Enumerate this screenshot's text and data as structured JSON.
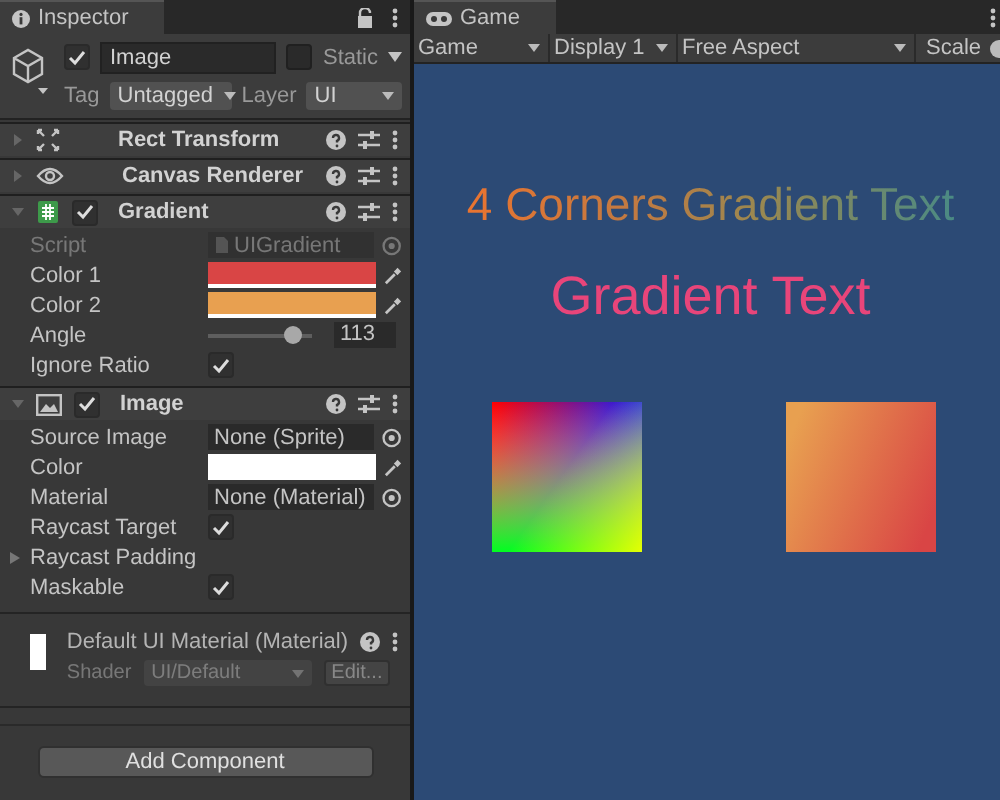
{
  "inspector": {
    "tab_title": "Inspector",
    "object": {
      "active": true,
      "name": "Image",
      "static": false,
      "static_label": "Static",
      "tag_label": "Tag",
      "tag": "Untagged",
      "layer_label": "Layer",
      "layer": "UI"
    },
    "components": [
      {
        "title": "Rect Transform",
        "kind": "transform",
        "expanded": false
      },
      {
        "title": "Canvas Renderer",
        "kind": "renderer",
        "expanded": false
      },
      {
        "title": "Gradient",
        "kind": "script",
        "expanded": true,
        "enabled": true,
        "fields": [
          {
            "kind": "object",
            "label": "Script",
            "value": "UIGradient",
            "disabled": true
          },
          {
            "kind": "color",
            "label": "Color 1",
            "color": "#d94545"
          },
          {
            "kind": "color",
            "label": "Color 2",
            "color": "#e8a050"
          },
          {
            "kind": "slider",
            "label": "Angle",
            "level": 0.8,
            "value": "113"
          },
          {
            "kind": "checkbox",
            "label": "Ignore Ratio",
            "checked": true
          }
        ]
      },
      {
        "title": "Image",
        "kind": "image",
        "expanded": true,
        "enabled": true,
        "fields": [
          {
            "kind": "object",
            "label": "Source Image",
            "value": "None (Sprite)",
            "disabled": false
          },
          {
            "kind": "color",
            "label": "Color",
            "color": "#ffffff"
          },
          {
            "kind": "object",
            "label": "Material",
            "value": "None (Material)",
            "disabled": false
          },
          {
            "kind": "checkbox",
            "label": "Raycast Target",
            "checked": true
          },
          {
            "kind": "foldout",
            "label": "Raycast Padding"
          },
          {
            "kind": "checkbox",
            "label": "Maskable",
            "checked": true
          }
        ]
      }
    ],
    "material": {
      "name": "Default UI Material (Material)",
      "shader_label": "Shader",
      "shader": "UI/Default",
      "edit": "Edit..."
    },
    "add_component": "Add Component"
  },
  "game": {
    "tab_title": "Game",
    "toolbar": [
      "Game",
      "Display 1",
      "Free Aspect"
    ],
    "scale_label": "Scale",
    "texts": [
      "4 Corners Gradient Text",
      "Gradient Text"
    ]
  }
}
